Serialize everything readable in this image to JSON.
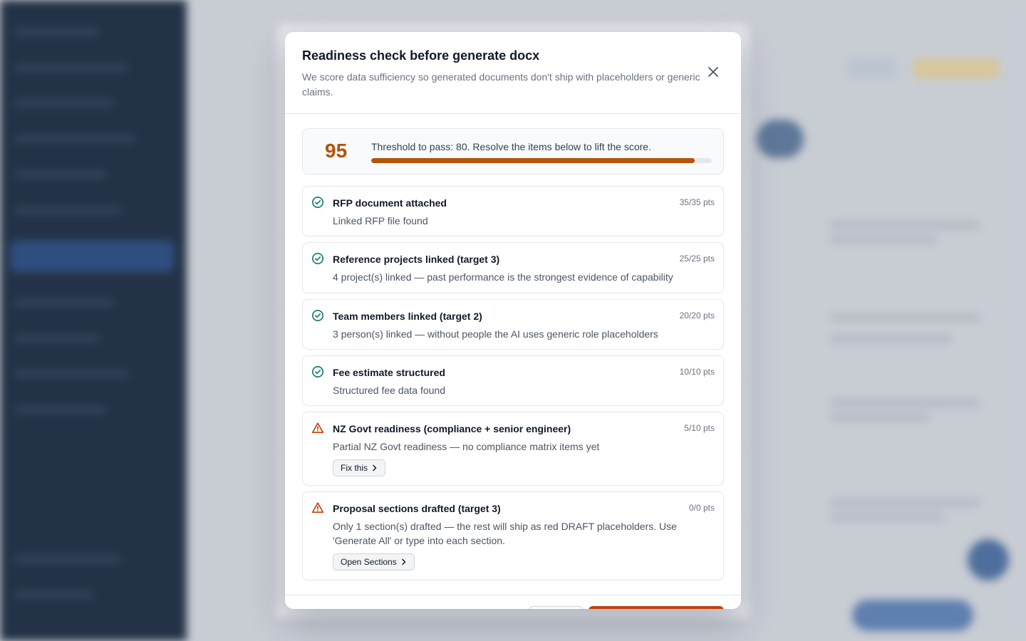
{
  "modal": {
    "title": "Readiness check before generate docx",
    "subtitle": "We score data sufficiency so generated documents don't ship with placeholders or generic claims."
  },
  "score": {
    "value": "95",
    "threshold_text": "Threshold to pass: 80. Resolve the items below to lift the score.",
    "progress_fraction": 0.95,
    "accent_color": "#b45309"
  },
  "items": [
    {
      "status": "pass",
      "icon": "check-circle-icon",
      "title": "RFP document attached",
      "points": "35/35 pts",
      "description": "Linked RFP file found"
    },
    {
      "status": "pass",
      "icon": "check-circle-icon",
      "title": "Reference projects linked (target 3)",
      "points": "25/25 pts",
      "description": "4 project(s) linked — past performance is the strongest evidence of capability"
    },
    {
      "status": "pass",
      "icon": "check-circle-icon",
      "title": "Team members linked (target 2)",
      "points": "20/20 pts",
      "description": "3 person(s) linked — without people the AI uses generic role placeholders"
    },
    {
      "status": "pass",
      "icon": "check-circle-icon",
      "title": "Fee estimate structured",
      "points": "10/10 pts",
      "description": "Structured fee data found"
    },
    {
      "status": "warning",
      "icon": "warning-triangle-icon",
      "title": "NZ Govt readiness (compliance + senior engineer)",
      "points": "5/10 pts",
      "description": "Partial NZ Govt readiness — no compliance matrix items yet",
      "action_label": "Fix this"
    },
    {
      "status": "warning",
      "icon": "warning-triangle-icon",
      "title": "Proposal sections drafted (target 3)",
      "points": "0/0 pts",
      "description": "Only 1 section(s) drafted — the rest will ship as red DRAFT placeholders. Use 'Generate All' or type into each section.",
      "action_label": "Open Sections"
    }
  ],
  "colors": {
    "pass": "#0f766e",
    "warning": "#c2410c"
  }
}
